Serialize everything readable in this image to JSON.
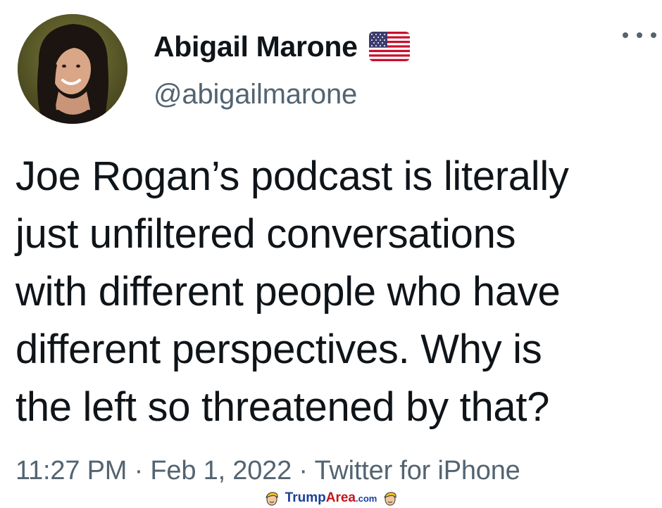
{
  "tweet": {
    "display_name": "Abigail Marone",
    "handle": "@abigailmarone",
    "text": "Joe Rogan’s podcast is literally\njust unfiltered conversations\nwith different people who have\ndifferent perspectives. Why is\nthe left so threatened by that?",
    "time": "11:27 PM",
    "date": "Feb 1, 2022",
    "source": "Twitter for iPhone",
    "separator": " · "
  },
  "icons": {
    "name_badge": "us-flag-icon",
    "overflow": "more-icon",
    "avatar": "avatar"
  },
  "watermark": {
    "brand_first": "Trump",
    "brand_second": "Area",
    "suffix": ".com"
  },
  "colors": {
    "text_primary": "#0f1419",
    "text_secondary": "#536471",
    "watermark_blue": "#1a3f9c",
    "watermark_red": "#c4161c"
  }
}
